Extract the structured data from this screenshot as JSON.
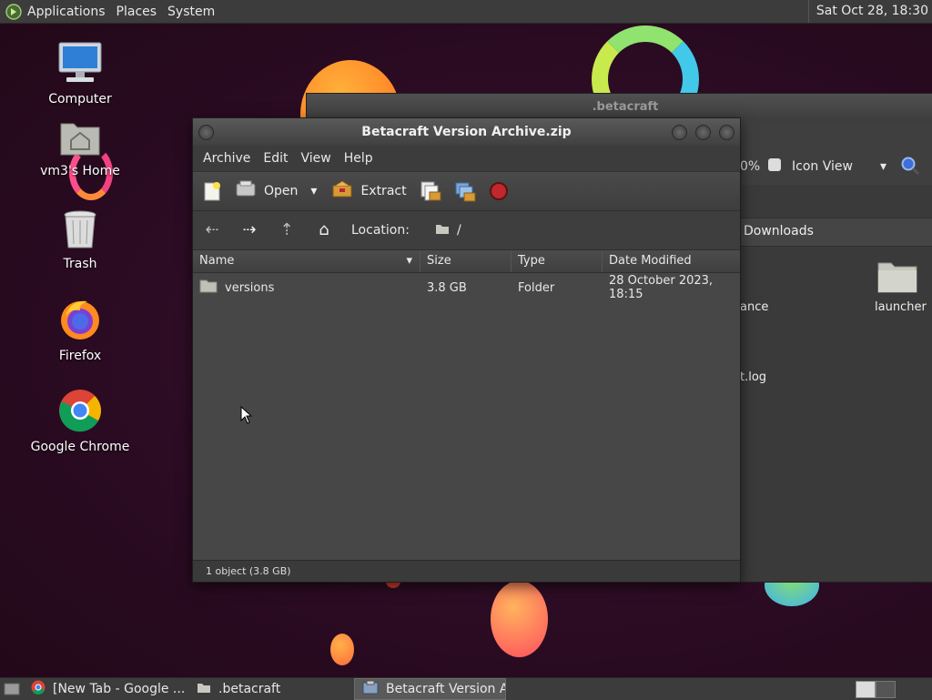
{
  "top_panel": {
    "menus": [
      "Applications",
      "Places",
      "System"
    ],
    "clock": "Sat Oct 28, 18:30"
  },
  "desktop_icons": [
    {
      "label": "Computer",
      "icon": "computer-icon"
    },
    {
      "label": "vm3's Home",
      "icon": "home-folder-icon"
    },
    {
      "label": "Trash",
      "icon": "trash-icon"
    },
    {
      "label": "Firefox",
      "icon": "firefox-icon"
    },
    {
      "label": "Google Chrome",
      "icon": "chrome-icon"
    }
  ],
  "back_window": {
    "title": ".betacraft",
    "zoom": "0%",
    "view_mode": "Icon View",
    "location_tab": "Downloads",
    "items": [
      {
        "label": "launcher",
        "icon": "folder-icon"
      },
      {
        "label": "ance"
      },
      {
        "label": "t.log"
      }
    ]
  },
  "window": {
    "title": "Betacraft Version Archive.zip",
    "menu": [
      "Archive",
      "Edit",
      "View",
      "Help"
    ],
    "toolbar": {
      "open_label": "Open",
      "extract_label": "Extract"
    },
    "location_label": "Location:",
    "location_path": "/",
    "columns": [
      "Name",
      "Size",
      "Type",
      "Date Modified"
    ],
    "rows": [
      {
        "name": "versions",
        "size": "3.8 GB",
        "type": "Folder",
        "date": "28 October 2023, 18:15"
      }
    ],
    "status": "1 object (3.8 GB)"
  },
  "taskbar": {
    "items": [
      {
        "label": "[New Tab - Google ...",
        "icon": "chrome-icon",
        "active": false
      },
      {
        "label": ".betacraft",
        "icon": "folder-icon",
        "active": false
      },
      {
        "label": "Betacraft Version Ar...",
        "icon": "archive-icon",
        "active": true
      }
    ]
  },
  "colors": {
    "desktop_bg": "#2a0b22",
    "panel": "#3c3c3c",
    "window": "#474747",
    "stop_button": "#c0282d"
  }
}
